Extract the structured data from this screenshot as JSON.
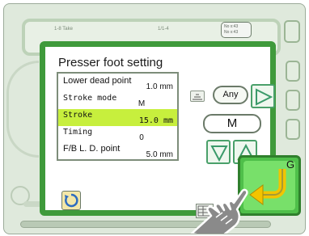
{
  "background": {
    "header_left": "1-8 Take",
    "header_mid": "1/1-4",
    "box1_line1": "No x:43",
    "box1_line2": "No x:43"
  },
  "dialog": {
    "title": "Presser foot setting",
    "rows": [
      {
        "label": "Lower dead point",
        "value": "1.0 mm",
        "selected": false
      },
      {
        "label": "Stroke mode",
        "value": "M",
        "selected": false
      },
      {
        "label": "Stroke",
        "value": "15.0 mm",
        "selected": true
      },
      {
        "label": "Timing",
        "value": "0",
        "selected": false
      },
      {
        "label": "F/B L. D. point",
        "value": "5.0 mm",
        "selected": false
      }
    ],
    "any_label": "Any",
    "mode_value": "M",
    "confirm_key": "G"
  },
  "colors": {
    "dialog_border": "#3f9a3b",
    "selected_row": "#c7ef3d",
    "confirm_button": "#4fbf4a"
  }
}
